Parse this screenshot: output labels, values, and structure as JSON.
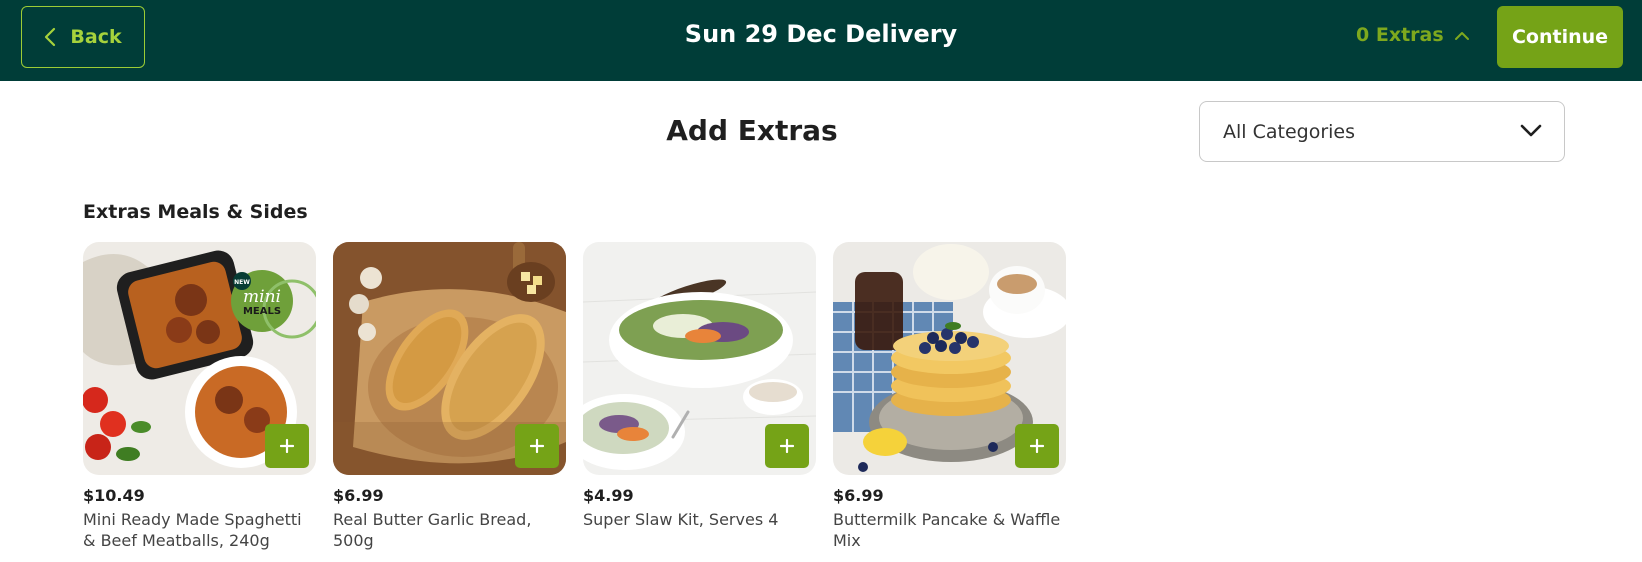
{
  "header": {
    "back_label": "Back",
    "title": "Sun 29 Dec Delivery",
    "extras_label": "0 Extras",
    "continue_label": "Continue"
  },
  "page": {
    "title": "Add Extras",
    "category_select": {
      "value": "All Categories"
    }
  },
  "section": {
    "title": "Extras Meals & Sides",
    "products": [
      {
        "price": "$10.49",
        "name": "Mini Ready Made Spaghetti & Beef Meatballs, 240g",
        "badge_new": "NEW",
        "badge_line1": "mini",
        "badge_line2": "MEALS"
      },
      {
        "price": "$6.99",
        "name": "Real Butter Garlic Bread, 500g"
      },
      {
        "price": "$4.99",
        "name": "Super Slaw Kit, Serves 4"
      },
      {
        "price": "$6.99",
        "name": "Buttermilk Pancake & Waffle Mix"
      }
    ]
  },
  "icons": {
    "back": "chevron-left-icon",
    "extras_toggle": "chevron-up-icon",
    "select": "chevron-down-icon",
    "add": "plus-icon"
  },
  "colors": {
    "header_bg": "#003d38",
    "accent_green": "#75a317",
    "light_green": "#a6d23c"
  }
}
